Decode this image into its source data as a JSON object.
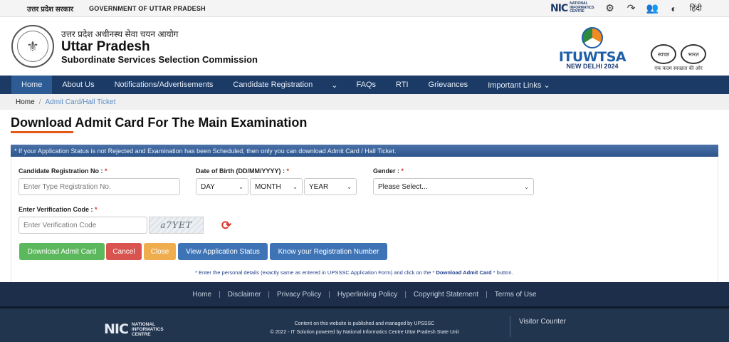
{
  "topbar": {
    "hindi_label": "उत्तर प्रदेश सरकार",
    "english_label": "GOVERNMENT OF UTTAR PRADESH",
    "nic_mark": "NIC",
    "nic_text_1": "NATIONAL",
    "nic_text_2": "INFORMATICS",
    "nic_text_3": "CENTRE",
    "icons": [
      "gear-icon",
      "audio-icon",
      "users-icon",
      "contrast-icon"
    ],
    "language": "हिंदी"
  },
  "header": {
    "hindi_title": "उत्तर प्रदेश अधीनस्थ सेवा चयन आयोग",
    "title": "Uttar Pradesh",
    "subtitle": "Subordinate Services Selection Commission",
    "itu_word": "ITUWTSA",
    "itu_city": "NEW DELHI 2024",
    "swachh_left": "स्वच्छ",
    "swachh_right": "भारत",
    "swachh_tag": "एक कदम स्वच्छता की ओर"
  },
  "nav": {
    "items": [
      {
        "label": "Home"
      },
      {
        "label": "About Us"
      },
      {
        "label": "Notifications/Advertisements"
      },
      {
        "label": "Candidate Registration"
      },
      {
        "label": "⌄"
      },
      {
        "label": "FAQs"
      },
      {
        "label": "RTI"
      },
      {
        "label": "Grievances"
      },
      {
        "label": "Important Links ⌄"
      }
    ]
  },
  "breadcrumb": {
    "home": "Home",
    "separator": "/",
    "current": "Admit Card/Hall Ticket"
  },
  "page": {
    "title": "Download Admit Card For The Main Examination",
    "info": "* If your Application Status is not Rejected and Examination has been Scheduled, then only you can download Admit Card / Hall Ticket."
  },
  "form": {
    "reg_label": "Candidate Registration No :",
    "reg_placeholder": "Enter Type Registration No.",
    "dob_label": "Date of Birth (DD/MM/YYYY) :",
    "day": "DAY",
    "month": "MONTH",
    "year": "YEAR",
    "gender_label": "Gender :",
    "gender_value": "Please Select...",
    "code_label": "Enter Verification Code :",
    "code_placeholder": "Enter Verification Code",
    "captcha": "a7YET",
    "required_mark": "*"
  },
  "buttons": {
    "download": "Download Admit Card",
    "cancel": "Cancel",
    "close": "Close",
    "status": "View Application Status",
    "know_reg": "Know your Registration Number"
  },
  "note": {
    "before": "* Enter the personal details (exactly same as entered in UPSSSC Application Form) and click on the *",
    "bold": "Download Admit Card",
    "after": "* button."
  },
  "footer": {
    "links": [
      "Home",
      "Disclaimer",
      "Privacy Policy",
      "Hyperlinking Policy",
      "Copyright Statement",
      "Terms of Use"
    ],
    "nic_mark": "NIC",
    "nic_text_1": "NATIONAL",
    "nic_text_2": "INFORMATICS",
    "nic_text_3": "CENTRE",
    "line1": "Content on this website is published and managed by UPSSSC",
    "line2": "© 2022 - IT Solution powered by National Informatics Centre Uttar Pradesh State Unit",
    "visitor": "Visitor Counter"
  },
  "colors": {
    "nav_bg": "#1b3a66",
    "accent_underline": "#e55a18",
    "green_btn": "#5cb85c",
    "red_btn": "#d9534f",
    "orange_btn": "#f0ad4e",
    "blue_btn": "#3e74b6"
  }
}
